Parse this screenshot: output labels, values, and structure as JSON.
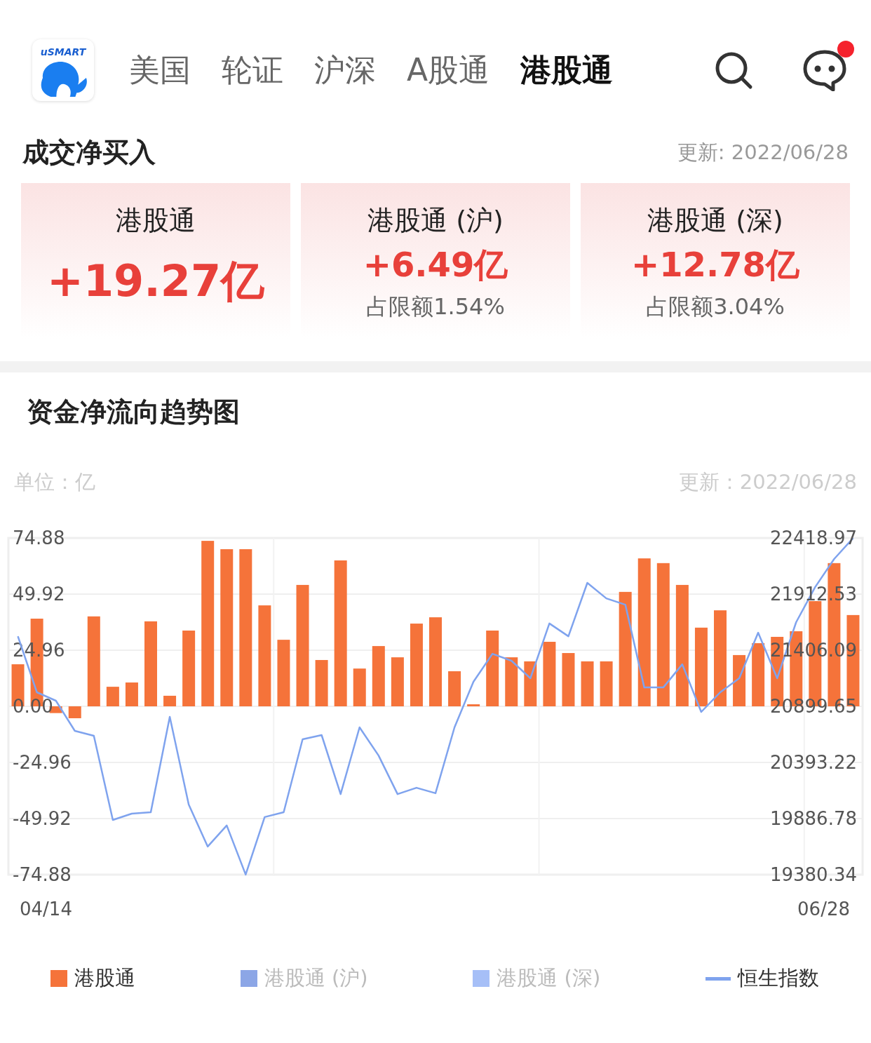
{
  "header": {
    "logo_text": "uSMART",
    "tabs": [
      {
        "label": "美国",
        "selected": false
      },
      {
        "label": "轮证",
        "selected": false
      },
      {
        "label": "沪深",
        "selected": false
      },
      {
        "label": "A股通",
        "selected": false
      },
      {
        "label": "港股通",
        "selected": true
      }
    ],
    "chat": {
      "has_unread": true
    }
  },
  "net_buy": {
    "title": "成交净买入",
    "updated": "更新: 2022/06/28",
    "cards": [
      {
        "kind": "main",
        "title": "港股通",
        "value": "+19.27亿"
      },
      {
        "kind": "sub",
        "title": "港股通 (沪)",
        "value": "+6.49亿",
        "quota": "占限额1.54%"
      },
      {
        "kind": "sub",
        "title": "港股通 (深)",
        "value": "+12.78亿",
        "quota": "占限额3.04%"
      }
    ]
  },
  "trend": {
    "title": "资金净流向趋势图",
    "unit": "单位：亿",
    "updated": "更新：2022/06/28",
    "chart_data": {
      "type": "bar",
      "ylim": [
        -74.88,
        74.88
      ],
      "yticks": [
        {
          "value": 74.88,
          "label": "74.88"
        },
        {
          "value": 49.92,
          "label": "49.92"
        },
        {
          "value": 24.96,
          "label": "24.96"
        },
        {
          "value": 0,
          "label": "0.00"
        },
        {
          "value": -24.96,
          "label": "-24.96"
        },
        {
          "value": -49.92,
          "label": "-49.92"
        },
        {
          "value": -74.88,
          "label": "-74.88"
        }
      ],
      "grid": true,
      "categories": [
        null,
        null,
        null,
        null,
        null,
        null,
        null,
        null,
        null,
        null,
        null,
        null,
        null,
        null,
        null,
        null,
        null,
        null,
        null,
        null,
        null,
        null,
        null,
        null,
        null,
        null,
        null,
        null,
        null,
        null,
        null,
        null,
        null,
        null,
        null,
        null,
        null,
        null,
        null,
        null,
        null,
        null,
        null,
        null,
        null
      ],
      "series": [
        {
          "color": "#f5733a",
          "values": [
            18.7,
            39,
            -3,
            -5.3,
            40,
            8.7,
            10.6,
            37.8,
            4.7,
            33.7,
            73.6,
            69.9,
            69.9,
            44.9,
            29.6,
            54,
            20.6,
            64.9,
            16.8,
            26.8,
            21.8,
            36.8,
            39.6,
            15.6,
            0.9,
            33.7,
            21.8,
            20,
            28.7,
            23.7,
            20,
            20,
            50.9,
            65.8,
            63.7,
            54,
            35,
            42.7,
            22.8,
            28.1,
            30.9,
            33.4,
            46.8,
            63.7,
            40.6
          ]
        }
      ]
    },
    "index_chart": {
      "chart_data": {
        "type": "line",
        "ylim": [
          19380.34,
          22418.97
        ],
        "yticks": [
          {
            "value": 22418.97,
            "label": "22418.97"
          },
          {
            "value": 21912.53,
            "label": "21912.53"
          },
          {
            "value": 21406.09,
            "label": "21406.09"
          },
          {
            "value": 20899.65,
            "label": "20899.65"
          },
          {
            "value": 20393.22,
            "label": "20393.22"
          },
          {
            "value": 19886.78,
            "label": "19886.78"
          },
          {
            "value": 19380.34,
            "label": "19380.34"
          }
        ],
        "series": [
          {
            "color": "#7fa3ee",
            "values": [
              21532,
              21026,
              20950,
              20678,
              20634,
              19874,
              19931,
              19944,
              20805,
              20013,
              19634,
              19824,
              19381,
              19900,
              19944,
              20602,
              20640,
              20108,
              20710,
              20456,
              20108,
              20165,
              20115,
              20710,
              21121,
              21374,
              21311,
              21153,
              21647,
              21532,
              22014,
              21874,
              21817,
              21070,
              21070,
              21279,
              20849,
              21026,
              21153,
              21564,
              21153,
              21659,
              21975,
              22229,
              22418
            ]
          }
        ]
      }
    },
    "start_date": "04/14",
    "end_date": "06/28",
    "legend": [
      {
        "kind": "square",
        "label": "港股通",
        "color": "#f5733a",
        "on": true
      },
      {
        "kind": "square",
        "label": "港股通 (沪)",
        "color": "#8ca6e6",
        "on": false
      },
      {
        "kind": "square",
        "label": "港股通 (深)",
        "color": "#a6bff7",
        "on": false
      },
      {
        "kind": "line",
        "label": "恒生指数",
        "color": "#7fa3ee",
        "on": true
      }
    ]
  }
}
